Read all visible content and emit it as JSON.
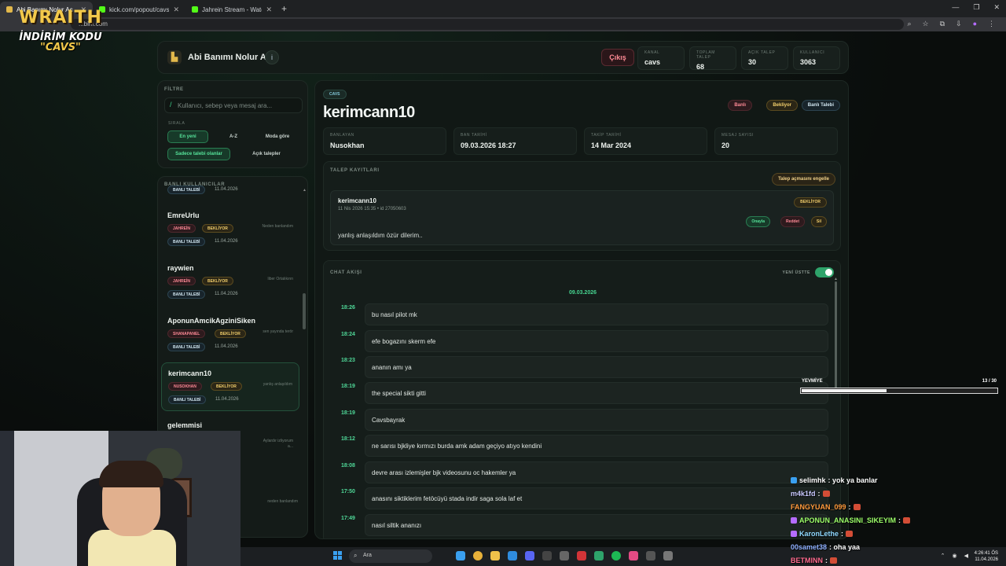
{
  "browser": {
    "tabs": [
      {
        "title": "Abi Banımı Nolur Aç",
        "color": "#e2b84b",
        "active": true
      },
      {
        "title": "kick.com/popout/cavs/chat",
        "color": "#53fc18",
        "active": false
      },
      {
        "title": "Jahrein Stream - Watch Live on",
        "color": "#53fc18",
        "active": false
      }
    ],
    "url": "...bim.com"
  },
  "overlay_logo": {
    "line1": "WRAITH",
    "line2": "İNDİRİM KODU",
    "line3": "\"CAVS\""
  },
  "header": {
    "title": "Abi Banımı Nolur Aç",
    "info_label": "i",
    "logout_label": "Çıkış",
    "stats": [
      {
        "label": "KANAL",
        "value": "cavs"
      },
      {
        "label": "TOPLAM TALEP",
        "value": "68"
      },
      {
        "label": "AÇIK TALEP",
        "value": "30"
      },
      {
        "label": "KULLANICI",
        "value": "3063"
      }
    ]
  },
  "filter": {
    "title": "FİLTRE",
    "search_placeholder": "Kullanıcı, sebep veya mesaj ara...",
    "sort_label": "SIRALA",
    "sort_options": [
      "En yeni",
      "A-Z",
      "Moda göre"
    ],
    "filter_options": [
      "Sadece talebi olanlar",
      "Açık talepler"
    ]
  },
  "userlist": {
    "title": "BANLI KULLANICILAR",
    "top_partial": {
      "pill": "BANLI TALEBİ",
      "date": "11.04.2026"
    },
    "items": [
      {
        "name": "EmreUrlu",
        "mod": "JAHREİN",
        "status": "BEKLİYOR",
        "type": "BANLI TALEBİ",
        "date": "11.04.2026",
        "note": "Neden banlandım"
      },
      {
        "name": "raywien",
        "mod": "JAHREİN",
        "status": "BEKLİYOR",
        "type": "BANLI TALEBİ",
        "date": "11.04.2026",
        "note": "liber Ortalıkınn"
      },
      {
        "name": "AponunAmcikAgziniSiken",
        "mod": "SHANAPANEL",
        "status": "BEKLİYOR",
        "type": "BANLI TALEBİ",
        "date": "11.04.2026",
        "note": "sen yayında terör"
      },
      {
        "name": "kerimcann10",
        "mod": "NUSOKHAN",
        "status": "BEKLİYOR",
        "type": "BANLI TALEBİ",
        "date": "11.04.2026",
        "note": "yanlış anlaşıldım"
      },
      {
        "name": "gelemmisi",
        "mod": "",
        "status": "",
        "type": "",
        "date": "",
        "note": "Aylardır izliyorum a..."
      }
    ],
    "bottom_partial_note": "neden banlandım"
  },
  "detail": {
    "channel": "CAVS",
    "username": "kerimcann10",
    "tags": [
      "Banlı",
      "Bekliyor",
      "Banlı Talebi"
    ],
    "info": [
      {
        "label": "BANLAYAN",
        "value": "Nusokhan"
      },
      {
        "label": "BAN TARİHİ",
        "value": "09.03.2026 18:27"
      },
      {
        "label": "TAKİP TARİHİ",
        "value": "14 Mar 2024"
      },
      {
        "label": "MESAJ SAYISI",
        "value": "20"
      }
    ],
    "requests": {
      "title": "TALEP KAYITLARI",
      "block_label": "Talep açmasını engelle",
      "item": {
        "name": "kerimcann10",
        "meta": "11 Nis 2026 15:35 • id 27050603",
        "status": "BEKLİYOR",
        "text": "yanlış anlaşıldım özür dilerim..",
        "actions": [
          "Onayla",
          "Reddet",
          "Sil"
        ]
      }
    },
    "chat": {
      "title": "CHAT AKIŞI",
      "toggle_label": "YENİ ÜSTTE",
      "date": "09.03.2026",
      "messages": [
        {
          "time": "18:26",
          "text": "bu nasıl pilot mk"
        },
        {
          "time": "18:24",
          "text": "efe bogazını skerm efe"
        },
        {
          "time": "18:23",
          "text": "ananın amı ya"
        },
        {
          "time": "18:19",
          "text": "the special sikti gitti"
        },
        {
          "time": "18:19",
          "text": "Cavsbayrak"
        },
        {
          "time": "18:12",
          "text": "ne sarısı bjkliye kırmızı burda amk adam geçiyo atıyo kendini"
        },
        {
          "time": "18:08",
          "text": "devre arası izlemişler bjk videosunu oc hakemler ya"
        },
        {
          "time": "17:50",
          "text": "anasını siktiklerim fetöcüyü stada indir saga sola laf et"
        },
        {
          "time": "17:49",
          "text": "nasıl siltik ananızı"
        }
      ]
    }
  },
  "yevmiye": {
    "label": "YEVMİYE",
    "count": "13 / 30",
    "progress": 0.433
  },
  "stream_chat": [
    {
      "user": "selimhk",
      "text": ": yok ya banlar",
      "color": "#ffffff",
      "emote": false,
      "badge": "#3aa0f0"
    },
    {
      "user": "m4k1fd",
      "text": ":",
      "color": "#c9c9ff",
      "emote": true,
      "badge": ""
    },
    {
      "user": "FANGYUAN_099",
      "text": ":",
      "color": "#ff9a3c",
      "emote": true,
      "badge": ""
    },
    {
      "user": "APONUN_ANASINI_SIKEYIM",
      "text": ":",
      "color": "#9dff6a",
      "emote": true,
      "badge": "#b56cff"
    },
    {
      "user": "KaronLethe",
      "text": ":",
      "color": "#8fd9ff",
      "emote": true,
      "badge": "#b56cff"
    },
    {
      "user": "00samet38",
      "text": ": oha yaa",
      "color": "#8fb0ff",
      "emote": false,
      "badge": ""
    },
    {
      "user": "BETMINN",
      "text": ":",
      "color": "#ff6a8e",
      "emote": true,
      "badge": ""
    }
  ],
  "taskbar": {
    "search_label": "Ara",
    "time": "4:26:41 ÖS",
    "date": "11.04.2026"
  }
}
